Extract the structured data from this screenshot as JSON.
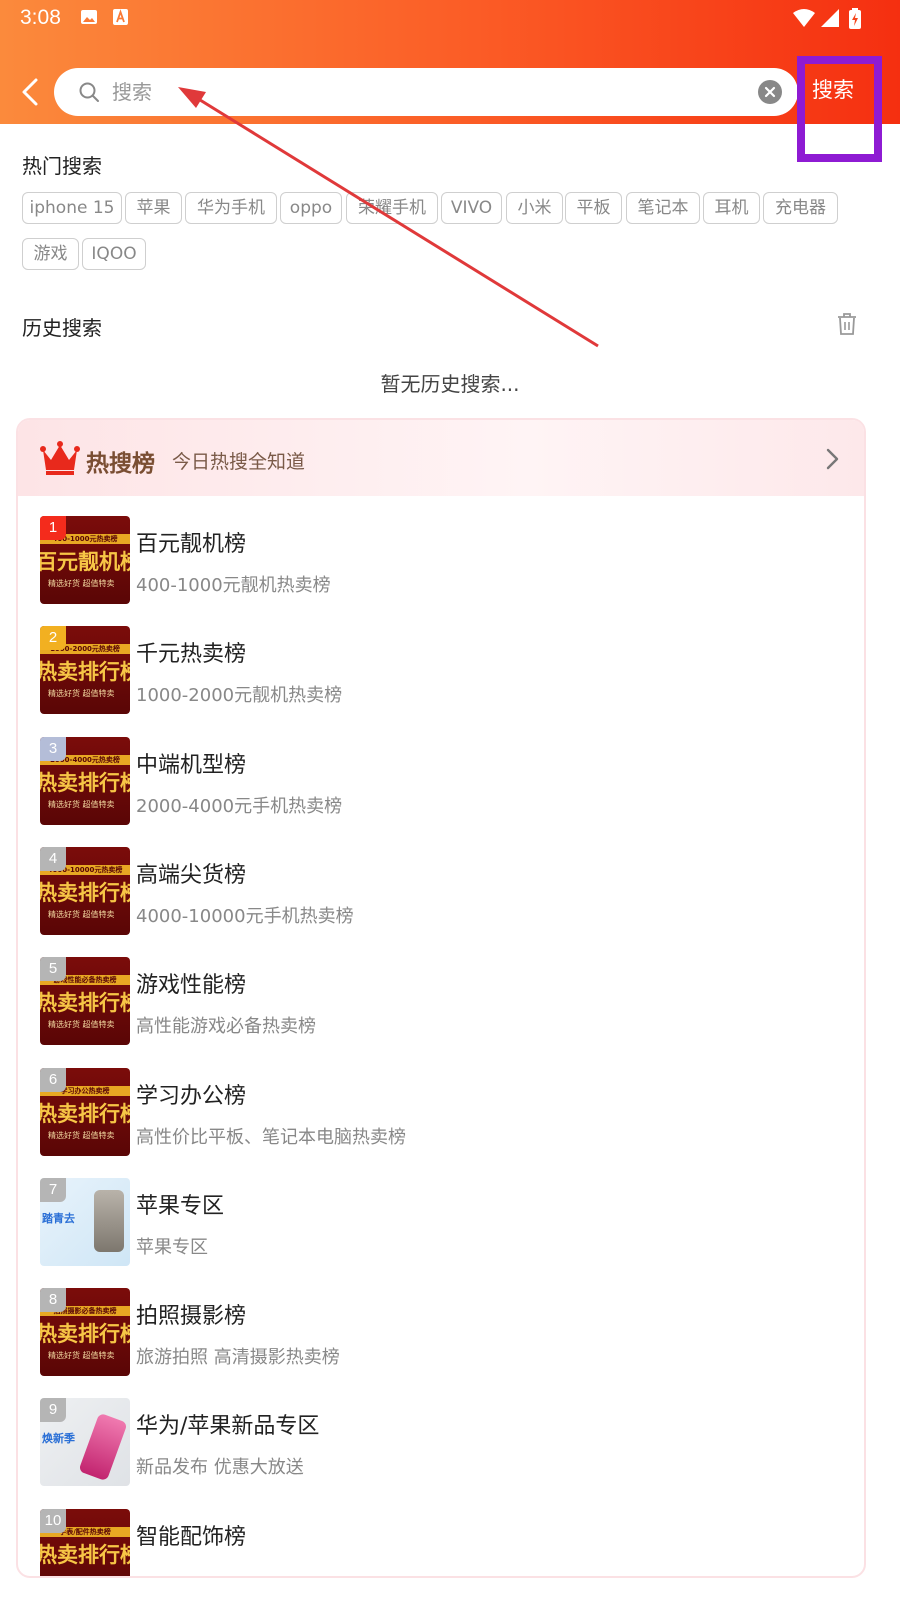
{
  "status_bar": {
    "time": "3:08"
  },
  "search": {
    "placeholder": "搜索",
    "value": "",
    "button_label": "搜索"
  },
  "hot_search": {
    "title": "热门搜索",
    "tags": [
      "iphone 15",
      "苹果",
      "华为手机",
      "oppo",
      "荣耀手机",
      "VIVO",
      "小米",
      "平板",
      "笔记本",
      "耳机",
      "充电器",
      "游戏",
      "IQOO"
    ]
  },
  "history": {
    "title": "历史搜索",
    "empty_text": "暂无历史搜索..."
  },
  "hot_list": {
    "title": "热搜榜",
    "subtitle": "今日热搜全知道",
    "items": [
      {
        "rank": "1",
        "title": "百元靓机榜",
        "subtitle": "400-1000元靓机热卖榜",
        "thumb_band": "400-1000元热卖榜",
        "thumb_big": "百元靓机榜",
        "thumb_small": "精选好货 超值特卖"
      },
      {
        "rank": "2",
        "title": "千元热卖榜",
        "subtitle": "1000-2000元靓机热卖榜",
        "thumb_band": "1000-2000元热卖榜",
        "thumb_big": "热卖排行榜",
        "thumb_small": "精选好货 超值特卖"
      },
      {
        "rank": "3",
        "title": "中端机型榜",
        "subtitle": "2000-4000元手机热卖榜",
        "thumb_band": "2000-4000元热卖榜",
        "thumb_big": "热卖排行榜",
        "thumb_small": "精选好货 超值特卖"
      },
      {
        "rank": "4",
        "title": "高端尖货榜",
        "subtitle": "4000-10000元手机热卖榜",
        "thumb_band": "4000-10000元热卖榜",
        "thumb_big": "热卖排行榜",
        "thumb_small": "精选好货 超值特卖"
      },
      {
        "rank": "5",
        "title": "游戏性能榜",
        "subtitle": "高性能游戏必备热卖榜",
        "thumb_band": "游戏性能必备热卖榜",
        "thumb_big": "热卖排行榜",
        "thumb_small": "精选好货 超值特卖"
      },
      {
        "rank": "6",
        "title": "学习办公榜",
        "subtitle": "高性价比平板、笔记本电脑热卖榜",
        "thumb_band": "学习办公热卖榜",
        "thumb_big": "热卖排行榜",
        "thumb_small": "精选好货 超值特卖"
      },
      {
        "rank": "7",
        "title": "苹果专区",
        "subtitle": "苹果专区",
        "thumb_band": "",
        "thumb_big": "踏青去",
        "thumb_small": ""
      },
      {
        "rank": "8",
        "title": "拍照摄影榜",
        "subtitle": "旅游拍照 高清摄影热卖榜",
        "thumb_band": "拍照摄影必备热卖榜",
        "thumb_big": "热卖排行榜",
        "thumb_small": "精选好货 超值特卖"
      },
      {
        "rank": "9",
        "title": "华为/苹果新品专区",
        "subtitle": "新品发布 优惠大放送",
        "thumb_band": "",
        "thumb_big": "焕新季",
        "thumb_small": ""
      },
      {
        "rank": "10",
        "title": "智能配饰榜",
        "subtitle": "",
        "thumb_band": "手表/配件热卖榜",
        "thumb_big": "热卖排行榜",
        "thumb_small": ""
      }
    ]
  },
  "colors": {
    "header_start": "#fb8a3c",
    "header_end": "#f52f10",
    "highlight": "#8e1bd3",
    "annotation_arrow": "#e0393a",
    "rank1": "#f42b1c",
    "rank2": "#f2b021",
    "rank3": "#b4bdd8",
    "rank_other": "#b5b5b5"
  }
}
